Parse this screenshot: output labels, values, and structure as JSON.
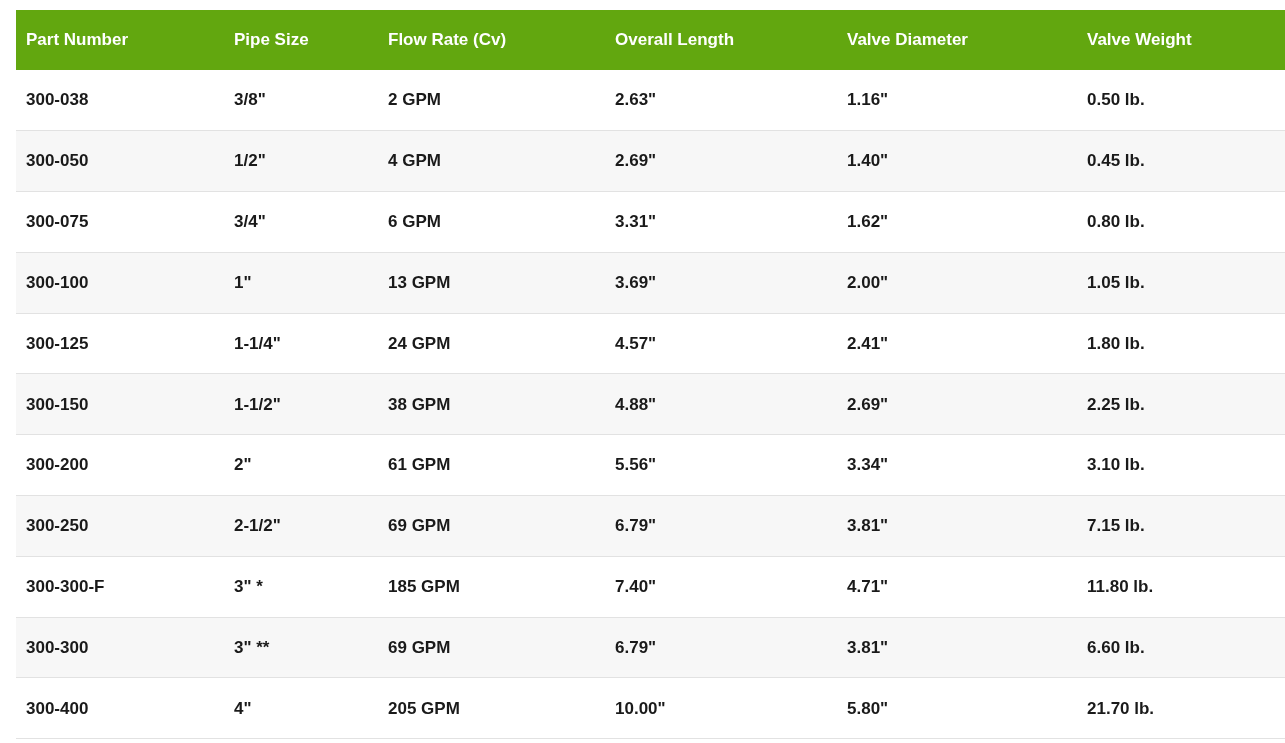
{
  "table": {
    "columns": [
      "Part Number",
      "Pipe Size",
      "Flow Rate (Cv)",
      "Overall Length",
      "Valve Diameter",
      "Valve Weight"
    ],
    "rows": [
      [
        "300-038",
        "3/8\"",
        "2 GPM",
        "2.63\"",
        "1.16\"",
        "0.50 lb."
      ],
      [
        "300-050",
        "1/2\"",
        "4 GPM",
        "2.69\"",
        "1.40\"",
        "0.45 lb."
      ],
      [
        "300-075",
        "3/4\"",
        "6 GPM",
        "3.31\"",
        "1.62\"",
        "0.80 lb."
      ],
      [
        "300-100",
        "1\"",
        "13 GPM",
        "3.69\"",
        "2.00\"",
        "1.05 lb."
      ],
      [
        "300-125",
        "1-1/4\"",
        "24 GPM",
        "4.57\"",
        "2.41\"",
        "1.80 lb."
      ],
      [
        "300-150",
        "1-1/2\"",
        "38 GPM",
        "4.88\"",
        "2.69\"",
        "2.25 lb."
      ],
      [
        "300-200",
        "2\"",
        "61 GPM",
        "5.56\"",
        "3.34\"",
        "3.10 lb."
      ],
      [
        "300-250",
        "2-1/2\"",
        "69 GPM",
        "6.79\"",
        "3.81\"",
        "7.15 lb."
      ],
      [
        "300-300-F",
        "3\" *",
        "185 GPM",
        "7.40\"",
        "4.71\"",
        "11.80 lb."
      ],
      [
        "300-300",
        "3\" **",
        "69 GPM",
        "6.79\"",
        "3.81\"",
        "6.60 lb."
      ],
      [
        "300-400",
        "4\"",
        "205 GPM",
        "10.00\"",
        "5.80\"",
        "21.70 lb."
      ]
    ]
  }
}
